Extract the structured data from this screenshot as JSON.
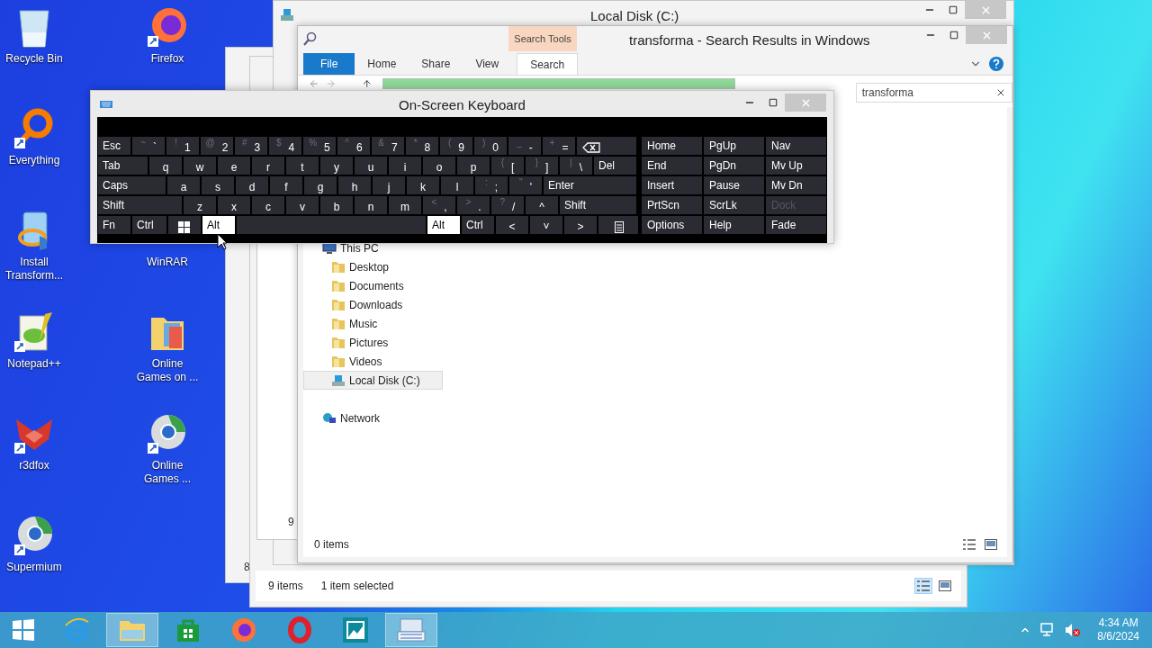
{
  "desktop_icons": [
    {
      "label": "Recycle Bin",
      "kind": "trash"
    },
    {
      "label": "Everything",
      "kind": "ring"
    },
    {
      "label": "Install Transform...",
      "kind": "installer"
    },
    {
      "label": "Notepad++",
      "kind": "notepad"
    },
    {
      "label": "r3dfox",
      "kind": "fox"
    },
    {
      "label": "Supermium",
      "kind": "globe"
    },
    {
      "label": "Firefox",
      "kind": "firefox"
    },
    {
      "label": "WinRAR",
      "kind": "hidden"
    },
    {
      "label": "Online Games on ...",
      "kind": "folder"
    },
    {
      "label": "Online Games ...",
      "kind": "globe"
    }
  ],
  "back_windows": [
    {
      "fragment": "8"
    },
    {
      "fragment": "9"
    }
  ],
  "back_explorer": {
    "status_items": "9 items",
    "status_selection": "1 item selected",
    "views": [
      {
        "kind": "details",
        "selected": true
      },
      {
        "kind": "tiles",
        "selected": false
      }
    ]
  },
  "local_disk_window": {
    "title": "Local Disk (C:)"
  },
  "search_window": {
    "title": "transforma - Search Results in Windows",
    "context_tab": "Search Tools",
    "ribbon_tabs": [
      {
        "label": "File",
        "kind": "file",
        "selected": false
      },
      {
        "label": "Home",
        "kind": "tab",
        "selected": false
      },
      {
        "label": "Share",
        "kind": "tab",
        "selected": false
      },
      {
        "label": "View",
        "kind": "tab",
        "selected": false
      },
      {
        "label": "Search",
        "kind": "tab",
        "selected": true
      }
    ],
    "search_value": "transforma",
    "nav_tree": [
      {
        "label": "This PC",
        "kind": "pc",
        "selected": false,
        "children": [
          {
            "label": "Desktop",
            "kind": "folder",
            "selected": false
          },
          {
            "label": "Documents",
            "kind": "folder",
            "selected": false
          },
          {
            "label": "Downloads",
            "kind": "folder",
            "selected": false
          },
          {
            "label": "Music",
            "kind": "folder",
            "selected": false
          },
          {
            "label": "Pictures",
            "kind": "folder",
            "selected": false
          },
          {
            "label": "Videos",
            "kind": "folder",
            "selected": false
          },
          {
            "label": "Local Disk (C:)",
            "kind": "drive",
            "selected": true
          }
        ]
      },
      {
        "label": "Network",
        "kind": "network",
        "selected": false
      }
    ],
    "status": "0 items",
    "views": [
      {
        "kind": "details",
        "selected": false
      },
      {
        "kind": "tiles",
        "selected": false
      }
    ]
  },
  "keyboard": {
    "title": "On-Screen Keyboard",
    "rows": [
      [
        {
          "kind": "word",
          "label": "Esc",
          "pressed": false
        },
        {
          "kind": "char",
          "label": "`",
          "shift": "~",
          "pressed": false
        },
        {
          "kind": "char",
          "label": "1",
          "shift": "!",
          "pressed": false
        },
        {
          "kind": "char",
          "label": "2",
          "shift": "@",
          "pressed": false
        },
        {
          "kind": "char",
          "label": "3",
          "shift": "#",
          "pressed": false
        },
        {
          "kind": "char",
          "label": "4",
          "shift": "$",
          "pressed": false
        },
        {
          "kind": "char",
          "label": "5",
          "shift": "%",
          "pressed": false
        },
        {
          "kind": "char",
          "label": "6",
          "shift": "^",
          "pressed": false
        },
        {
          "kind": "char",
          "label": "7",
          "shift": "&",
          "pressed": false
        },
        {
          "kind": "char",
          "label": "8",
          "shift": "*",
          "pressed": false
        },
        {
          "kind": "char",
          "label": "9",
          "shift": "(",
          "pressed": false
        },
        {
          "kind": "char",
          "label": "0",
          "shift": ")",
          "pressed": false
        },
        {
          "kind": "char",
          "label": "-",
          "shift": "_",
          "pressed": false
        },
        {
          "kind": "char",
          "label": "=",
          "shift": "+",
          "pressed": false
        },
        {
          "kind": "backspace",
          "pressed": false
        }
      ],
      [
        {
          "kind": "word",
          "label": "Tab",
          "pressed": false
        },
        {
          "kind": "char",
          "label": "q",
          "pressed": false
        },
        {
          "kind": "char",
          "label": "w",
          "pressed": false
        },
        {
          "kind": "char",
          "label": "e",
          "pressed": false
        },
        {
          "kind": "char",
          "label": "r",
          "pressed": false
        },
        {
          "kind": "char",
          "label": "t",
          "pressed": false
        },
        {
          "kind": "char",
          "label": "y",
          "pressed": false
        },
        {
          "kind": "char",
          "label": "u",
          "pressed": false
        },
        {
          "kind": "char",
          "label": "i",
          "pressed": false
        },
        {
          "kind": "char",
          "label": "o",
          "pressed": false
        },
        {
          "kind": "char",
          "label": "p",
          "pressed": false
        },
        {
          "kind": "char",
          "label": "[",
          "shift": "{",
          "pressed": false
        },
        {
          "kind": "char",
          "label": "]",
          "shift": "}",
          "pressed": false
        },
        {
          "kind": "char",
          "label": "\\",
          "shift": "|",
          "pressed": false
        },
        {
          "kind": "word",
          "label": "Del",
          "pressed": false
        }
      ],
      [
        {
          "kind": "word",
          "label": "Caps",
          "pressed": false
        },
        {
          "kind": "char",
          "label": "a",
          "pressed": false
        },
        {
          "kind": "char",
          "label": "s",
          "pressed": false
        },
        {
          "kind": "char",
          "label": "d",
          "pressed": false
        },
        {
          "kind": "char",
          "label": "f",
          "pressed": false
        },
        {
          "kind": "char",
          "label": "g",
          "pressed": false
        },
        {
          "kind": "char",
          "label": "h",
          "pressed": false
        },
        {
          "kind": "char",
          "label": "j",
          "pressed": false
        },
        {
          "kind": "char",
          "label": "k",
          "pressed": false
        },
        {
          "kind": "char",
          "label": "l",
          "pressed": false
        },
        {
          "kind": "char",
          "label": ";",
          "shift": ":",
          "pressed": false
        },
        {
          "kind": "char",
          "label": "'",
          "shift": "\"",
          "pressed": false
        },
        {
          "kind": "word",
          "label": "Enter",
          "pressed": false
        }
      ],
      [
        {
          "kind": "word",
          "label": "Shift",
          "pressed": false
        },
        {
          "kind": "char",
          "label": "z",
          "pressed": false
        },
        {
          "kind": "char",
          "label": "x",
          "pressed": false
        },
        {
          "kind": "char",
          "label": "c",
          "pressed": false
        },
        {
          "kind": "char",
          "label": "v",
          "pressed": false
        },
        {
          "kind": "char",
          "label": "b",
          "pressed": false
        },
        {
          "kind": "char",
          "label": "n",
          "pressed": false
        },
        {
          "kind": "char",
          "label": "m",
          "pressed": false
        },
        {
          "kind": "char",
          "label": ",",
          "shift": "<",
          "pressed": false
        },
        {
          "kind": "char",
          "label": ".",
          "shift": ">",
          "pressed": false
        },
        {
          "kind": "char",
          "label": "/",
          "shift": "?",
          "pressed": false
        },
        {
          "kind": "char",
          "label": "^",
          "pressed": false
        },
        {
          "kind": "word",
          "label": "Shift",
          "pressed": false
        }
      ],
      [
        {
          "kind": "word",
          "label": "Fn",
          "pressed": false
        },
        {
          "kind": "word",
          "label": "Ctrl",
          "pressed": false
        },
        {
          "kind": "windows",
          "pressed": false
        },
        {
          "kind": "word",
          "label": "Alt",
          "pressed": true
        },
        {
          "kind": "space",
          "pressed": false
        },
        {
          "kind": "word",
          "label": "Alt",
          "pressed": true
        },
        {
          "kind": "word",
          "label": "Ctrl",
          "pressed": false
        },
        {
          "kind": "char",
          "label": "<",
          "pressed": false
        },
        {
          "kind": "char",
          "label": "˅",
          "pressed": false
        },
        {
          "kind": "char",
          "label": ">",
          "pressed": false
        },
        {
          "kind": "menu",
          "pressed": false
        }
      ]
    ],
    "nav_rows": [
      [
        {
          "label": "Home",
          "disabled": false
        },
        {
          "label": "PgUp",
          "disabled": false
        },
        {
          "label": "Nav",
          "disabled": false
        }
      ],
      [
        {
          "label": "End",
          "disabled": false
        },
        {
          "label": "PgDn",
          "disabled": false
        },
        {
          "label": "Mv Up",
          "disabled": false
        }
      ],
      [
        {
          "label": "Insert",
          "disabled": false
        },
        {
          "label": "Pause",
          "disabled": false
        },
        {
          "label": "Mv Dn",
          "disabled": false
        }
      ],
      [
        {
          "label": "PrtScn",
          "disabled": false
        },
        {
          "label": "ScrLk",
          "disabled": false
        },
        {
          "label": "Dock",
          "disabled": true
        }
      ],
      [
        {
          "label": "Options",
          "disabled": false
        },
        {
          "label": "Help",
          "disabled": false
        },
        {
          "label": "Fade",
          "disabled": false
        }
      ]
    ]
  },
  "taskbar": {
    "items": [
      {
        "kind": "ie",
        "active": false
      },
      {
        "kind": "explorer",
        "active": true
      },
      {
        "kind": "store",
        "active": false
      },
      {
        "kind": "firefox",
        "active": false
      },
      {
        "kind": "opera",
        "active": false
      },
      {
        "kind": "photos",
        "active": false
      },
      {
        "kind": "keyboard",
        "active": true
      }
    ],
    "time": "4:34 AM",
    "date": "8/6/2024"
  }
}
